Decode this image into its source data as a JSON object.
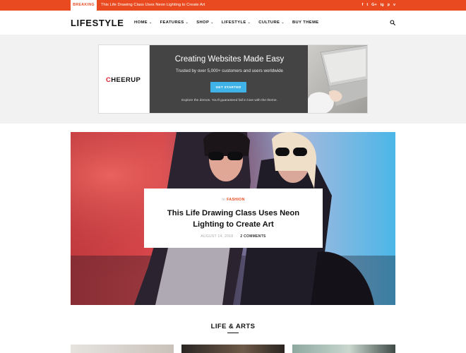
{
  "topbar": {
    "breaking_label": "BREAKING",
    "breaking_text": "This Life Drawing Class Uses Neon Lighting to Create Art",
    "social": [
      "f",
      "t",
      "G+",
      "ig",
      "p",
      "v"
    ]
  },
  "header": {
    "logo": "LIFESTYLE",
    "nav": [
      "HOME",
      "FEATURES",
      "SHOP",
      "LIFESTYLE",
      "CULTURE",
      "BUY THEME"
    ]
  },
  "ad": {
    "logo_first": "C",
    "logo_rest": "HEERUP",
    "title": "Creating Websites Made Easy",
    "subtitle": "Trusted by over 5,000+ customers and users worldwide",
    "button": "GET STARTED",
    "footer": "Explore the demos. You'll guaranteed fall in love with the theme."
  },
  "featured": {
    "category_prefix": "In",
    "category": "FASHION",
    "title": "This Life Drawing Class Uses Neon Lighting to Create Art",
    "date": "AUGUST 14, 2018",
    "comments": "2 COMMENTS"
  },
  "section": {
    "title": "LIFE & ARTS"
  },
  "colors": {
    "accent": "#ea4a1f",
    "button": "#3fb3e8"
  }
}
